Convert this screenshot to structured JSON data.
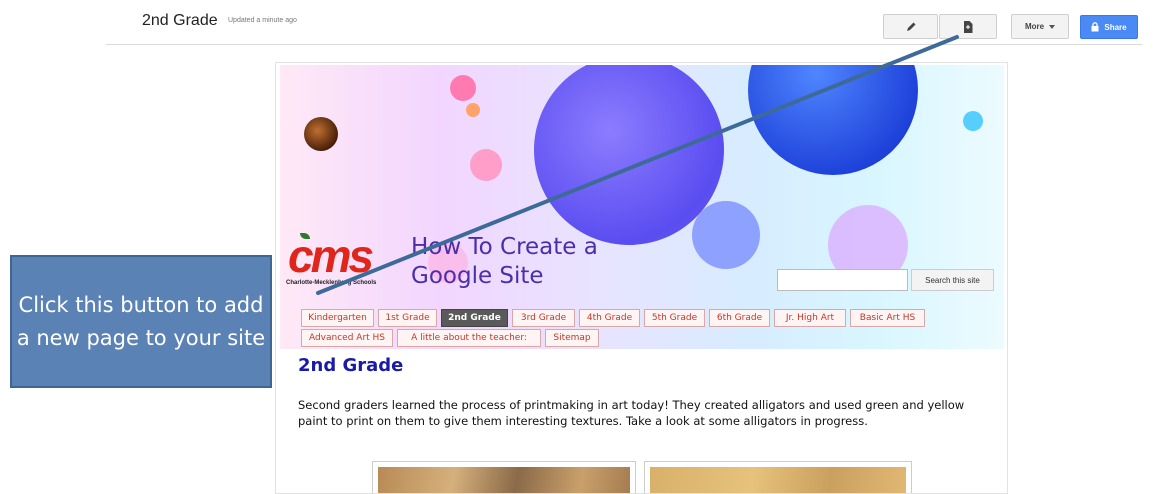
{
  "topbar": {
    "site_title": "2nd Grade",
    "updated": "Updated a minute ago",
    "more_label": "More",
    "share_label": "Share",
    "icons": [
      "pencil-icon",
      "new-page-icon",
      "caret-down-icon",
      "lock-icon"
    ]
  },
  "site": {
    "logo_text": "cms",
    "logo_subtext": "Charlotte-Mecklenburg Schools",
    "name_line1": "How To Create a",
    "name_line2": "Google Site",
    "search_button": "Search this site",
    "tabs": [
      "Kindergarten",
      "1st Grade",
      "2nd Grade",
      "3rd Grade",
      "4th Grade",
      "5th Grade",
      "6th Grade",
      "Jr. High Art",
      "Basic Art HS",
      "Advanced Art HS",
      "A little about the teacher:",
      "Sitemap"
    ],
    "active_tab": "2nd Grade",
    "page_heading": "2nd Grade",
    "body": "Second graders learned the process of printmaking in art today! They created alligators and used green and yellow paint to print on them to give them interesting textures. Take a look at some alligators in progress."
  },
  "callout": {
    "text": "Click this button to add a new page to your site"
  },
  "colors": {
    "share_button": "#4a8af4",
    "callout_fill": "#5b82b5",
    "tab_text": "#c0392b",
    "heading": "#1a1aa8"
  }
}
